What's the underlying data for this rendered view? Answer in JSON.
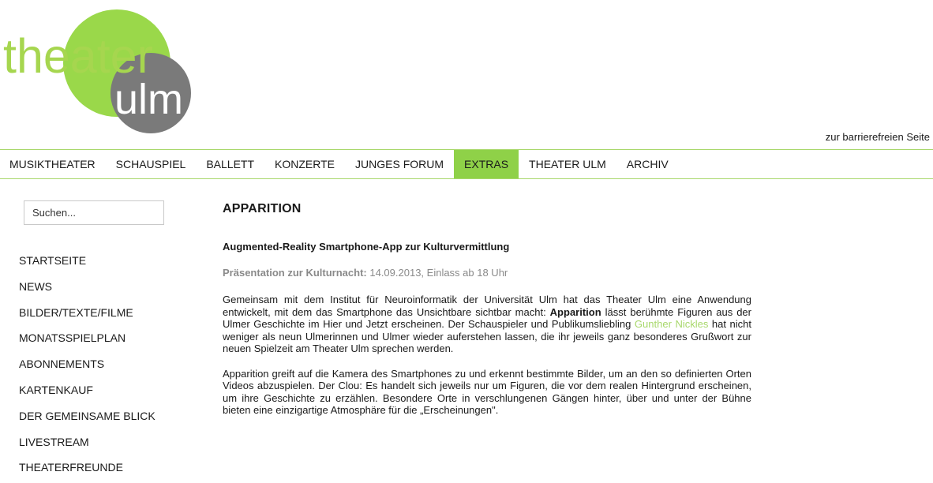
{
  "logo": {
    "word1": "theater",
    "word2": "ulm",
    "colors": {
      "green": "#9ad84a",
      "gray": "#7a7a7a",
      "text_green": "#a6d64f",
      "white": "#ffffff"
    }
  },
  "accessible_link": "zur barrierefreien Seite",
  "nav": {
    "items": [
      {
        "label": "MUSIKTHEATER",
        "active": false
      },
      {
        "label": "SCHAUSPIEL",
        "active": false
      },
      {
        "label": "BALLETT",
        "active": false
      },
      {
        "label": "KONZERTE",
        "active": false
      },
      {
        "label": "JUNGES FORUM",
        "active": false
      },
      {
        "label": "EXTRAS",
        "active": true
      },
      {
        "label": "THEATER ULM",
        "active": false
      },
      {
        "label": "ARCHIV",
        "active": false
      }
    ],
    "accent": "#8fd148",
    "border": "#a8d86b"
  },
  "search": {
    "placeholder": "Suchen..."
  },
  "sidebar": {
    "items": [
      "STARTSEITE",
      "NEWS",
      "BILDER/TEXTE/FILME",
      "MONATSSPIELPLAN",
      "ABONNEMENTS",
      "KARTENKAUF",
      "DER GEMEINSAME BLICK",
      "LIVESTREAM",
      "THEATERFREUNDE"
    ]
  },
  "content": {
    "title": "APPARITION",
    "subtitle": "Augmented-Reality Smartphone-App zur Kulturvermittlung",
    "meta_label": "Präsentation zur Kulturnacht:",
    "meta_value": " 14.09.2013, Einlass ab 18 Uhr",
    "p1": {
      "a": "Gemeinsam mit dem Institut für Neuroinformatik der Universität Ulm hat das Theater Ulm eine Anwendung entwickelt, mit dem das Smartphone das Unsichtbare sichtbar macht: ",
      "b": "Apparition",
      "c": " lässt berühmte Figuren aus der Ulmer Geschichte im Hier und Jetzt erscheinen. Der Schauspieler und Publikumsliebling ",
      "link": "Gunther Nickles",
      "d": " hat nicht weniger als neun Ulmerinnen und Ulmer wieder auferstehen lassen, die ihr jeweils ganz besonderes Grußwort zur neuen Spielzeit am Theater Ulm sprechen werden."
    },
    "p2": "Apparition greift auf die Kamera des Smartphones zu und erkennt bestimmte Bilder, um an den so definierten Orten Videos abzuspielen. Der Clou: Es handelt sich jeweils nur um Figuren, die vor dem realen Hintergrund erscheinen, um ihre Geschichte zu erzählen. Besondere Orte in verschlungenen Gängen hinter, über und unter der Bühne bieten eine einzigartige Atmosphäre für die „Erscheinungen\"."
  }
}
